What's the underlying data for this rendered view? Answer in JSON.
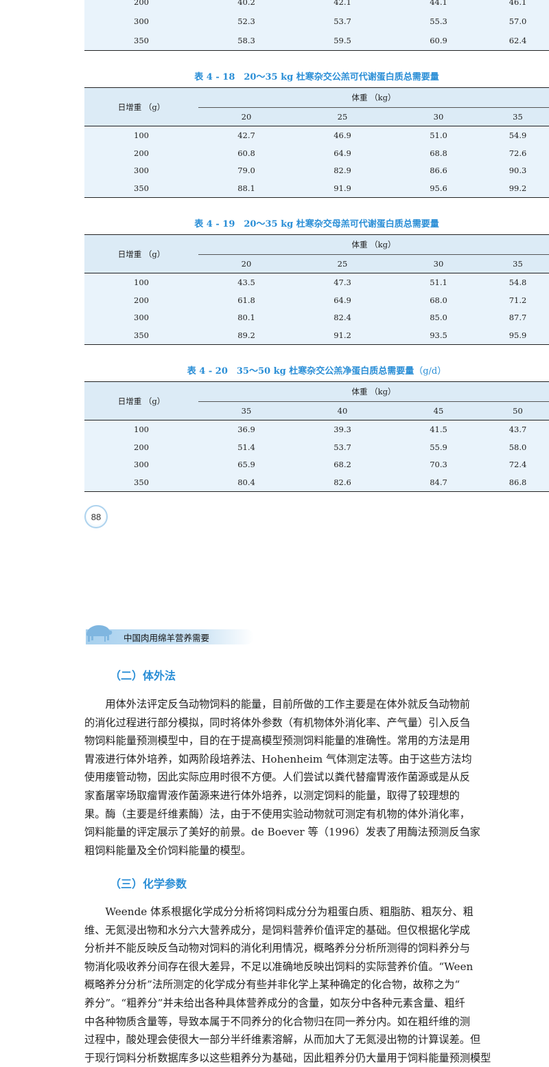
{
  "table_top_fragment": {
    "rows": [
      [
        "200",
        "40.2",
        "42.1",
        "44.1",
        "46.1"
      ],
      [
        "300",
        "52.3",
        "53.7",
        "55.3",
        "57.0"
      ],
      [
        "350",
        "58.3",
        "59.5",
        "60.9",
        "62.4"
      ]
    ]
  },
  "table_4_18": {
    "title": "表 4 - 18　20～35 kg 杜寒杂交公羔可代谢蛋白质总需要量",
    "row_header": "日增重 （g）",
    "col_group": "体重 （kg）",
    "cols": [
      "20",
      "25",
      "30",
      "35"
    ],
    "rows": [
      [
        "100",
        "42.7",
        "46.9",
        "51.0",
        "54.9"
      ],
      [
        "200",
        "60.8",
        "64.9",
        "68.8",
        "72.6"
      ],
      [
        "300",
        "79.0",
        "82.9",
        "86.6",
        "90.3"
      ],
      [
        "350",
        "88.1",
        "91.9",
        "95.6",
        "99.2"
      ]
    ]
  },
  "table_4_19": {
    "title": "表 4 - 19　20～35 kg 杜寒杂交母羔可代谢蛋白质总需要量",
    "row_header": "日增重 （g）",
    "col_group": "体重 （kg）",
    "cols": [
      "20",
      "25",
      "30",
      "35"
    ],
    "rows": [
      [
        "100",
        "43.5",
        "47.3",
        "51.1",
        "54.8"
      ],
      [
        "200",
        "61.8",
        "64.9",
        "68.0",
        "71.2"
      ],
      [
        "300",
        "80.1",
        "82.4",
        "85.0",
        "87.7"
      ],
      [
        "350",
        "89.2",
        "91.2",
        "93.5",
        "95.9"
      ]
    ]
  },
  "table_4_20": {
    "title": "表 4 - 20　35～50 kg 杜寒杂交公羔净蛋白质总需要量",
    "title_unit": "（g/d）",
    "row_header": "日增重 （g）",
    "col_group": "体重 （kg）",
    "cols": [
      "35",
      "40",
      "45",
      "50"
    ],
    "rows": [
      [
        "100",
        "36.9",
        "39.3",
        "41.5",
        "43.7"
      ],
      [
        "200",
        "51.4",
        "53.7",
        "55.9",
        "58.0"
      ],
      [
        "300",
        "65.9",
        "68.2",
        "70.3",
        "72.4"
      ],
      [
        "350",
        "80.4",
        "82.6",
        "84.7",
        "86.8"
      ]
    ]
  },
  "page_number": "88",
  "running_header": "中国肉用绵羊营养需要",
  "section_2": {
    "heading": "（二）体外法",
    "lines": [
      "　　用体外法评定反刍动物饲料的能量，目前所做的工作主要是在体外就反刍动物前",
      "的消化过程进行部分模拟，同时将体外参数（有机物体外消化率、产气量）引入反刍",
      "物饲料能量预测模型中，目的在于提高模型预测饲料能量的准确性。常用的方法是用",
      "胃液进行体外培养，如两阶段培养法、Hohenheim 气体测定法等。由于这些方法均",
      "使用瘘管动物，因此实际应用时很不方便。人们尝试以粪代替瘤胃液作菌源或是从反",
      "家畜屠宰场取瘤胃液作菌源来进行体外培养，以测定饲料的能量，取得了较理想的",
      "果。酶（主要是纤维素酶）法，由于不使用实验动物就可测定有机物的体外消化率，",
      "饲料能量的评定展示了美好的前景。de Boever 等（1996）发表了用酶法预测反刍家",
      "粗饲料能量及全价饲料能量的模型。"
    ]
  },
  "section_3": {
    "heading": "（三）化学参数",
    "lines": [
      "　　Weende 体系根据化学成分分析将饲料成分分为粗蛋白质、粗脂肪、粗灰分、粗",
      "维、无氮浸出物和水分六大营养成分，是饲料营养价值评定的基础。但仅根据化学成",
      "分析并不能反映反刍动物对饲料的消化利用情况，概略养分分析所测得的饲料养分与",
      "物消化吸收养分间存在很大差异，不足以准确地反映出饲料的实际营养价值。“Ween",
      "概略养分分析”法所测定的化学成分有些并非化学上某种确定的化合物，故称之为“",
      "养分”。“粗养分”并未给出各种具体营养成分的含量，如灰分中各种元素含量、粗纤",
      "中各种物质含量等，导致本属于不同养分的化合物归在同一养分内。如在粗纤维的测",
      "过程中，酸处理会使很大一部分半纤维素溶解，从而加大了无氮浸出物的计算误差。但",
      "于现行饲料分析数据库多以这些粗养分为基础，因此粗养分仍大量用于饲料能量预测模型"
    ]
  }
}
